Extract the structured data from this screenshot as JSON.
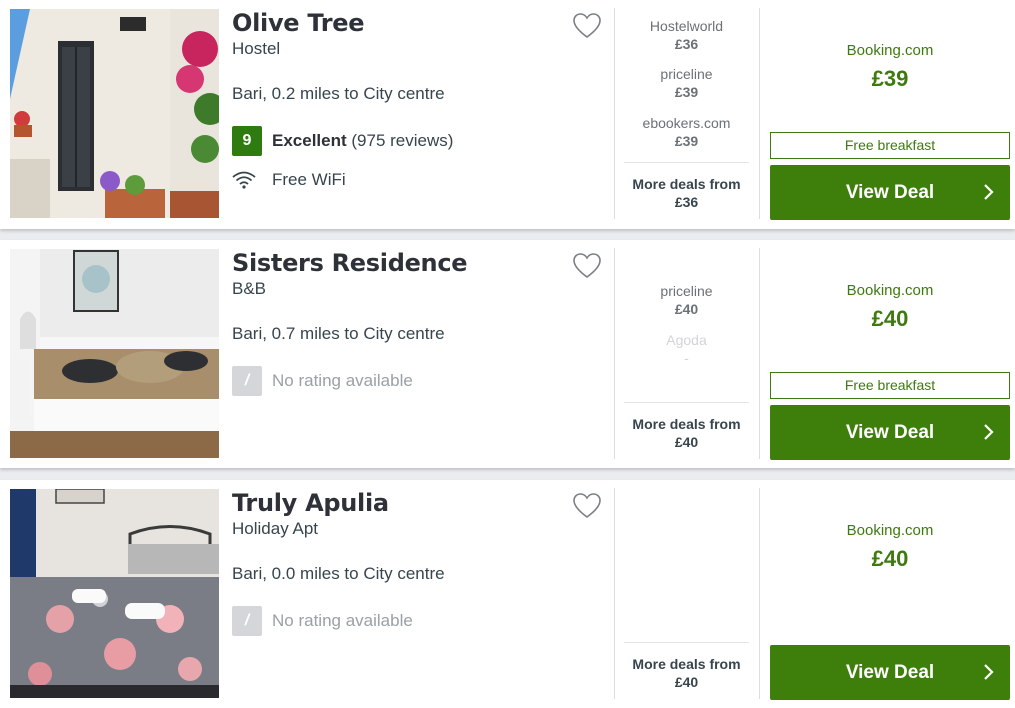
{
  "colors": {
    "accent": "#3e7f0c",
    "rating": "#2e7b0f",
    "provider": "#3e7a10",
    "background": "#ebecf0"
  },
  "icons": {
    "favourite": "heart-outline-icon",
    "wifi": "wifi-icon",
    "next": "chevron-right-icon"
  },
  "listings": [
    {
      "name": "Olive Tree",
      "type": "Hostel",
      "location": "Bari, 0.2 miles to City centre",
      "rating_score": "9",
      "rating_label": "Excellent",
      "rating_reviews": "(975 reviews)",
      "amenity": "Free WiFi",
      "deals": [
        {
          "provider": "Hostelworld",
          "price": "£36"
        },
        {
          "provider": "priceline",
          "price": "£39"
        },
        {
          "provider": "ebookers.com",
          "price": "£39"
        }
      ],
      "more_label": "More deals from",
      "more_price": "£36",
      "best_provider": "Booking.com",
      "best_price": "£39",
      "perk": "Free breakfast",
      "button": "View Deal"
    },
    {
      "name": "Sisters Residence",
      "type": "B&B",
      "location": "Bari, 0.7 miles to City centre",
      "rating_score": "/",
      "rating_label": "No rating available",
      "deals": [
        {
          "provider": "priceline",
          "price": "£40"
        },
        {
          "provider": "Agoda",
          "price": "-"
        }
      ],
      "more_label": "More deals from",
      "more_price": "£40",
      "best_provider": "Booking.com",
      "best_price": "£40",
      "perk": "Free breakfast",
      "button": "View Deal"
    },
    {
      "name": "Truly Apulia",
      "type": "Holiday Apt",
      "location": "Bari, 0.0 miles to City centre",
      "rating_score": "/",
      "rating_label": "No rating available",
      "more_label": "More deals from",
      "more_price": "£40",
      "best_provider": "Booking.com",
      "best_price": "£40",
      "button": "View Deal"
    }
  ]
}
